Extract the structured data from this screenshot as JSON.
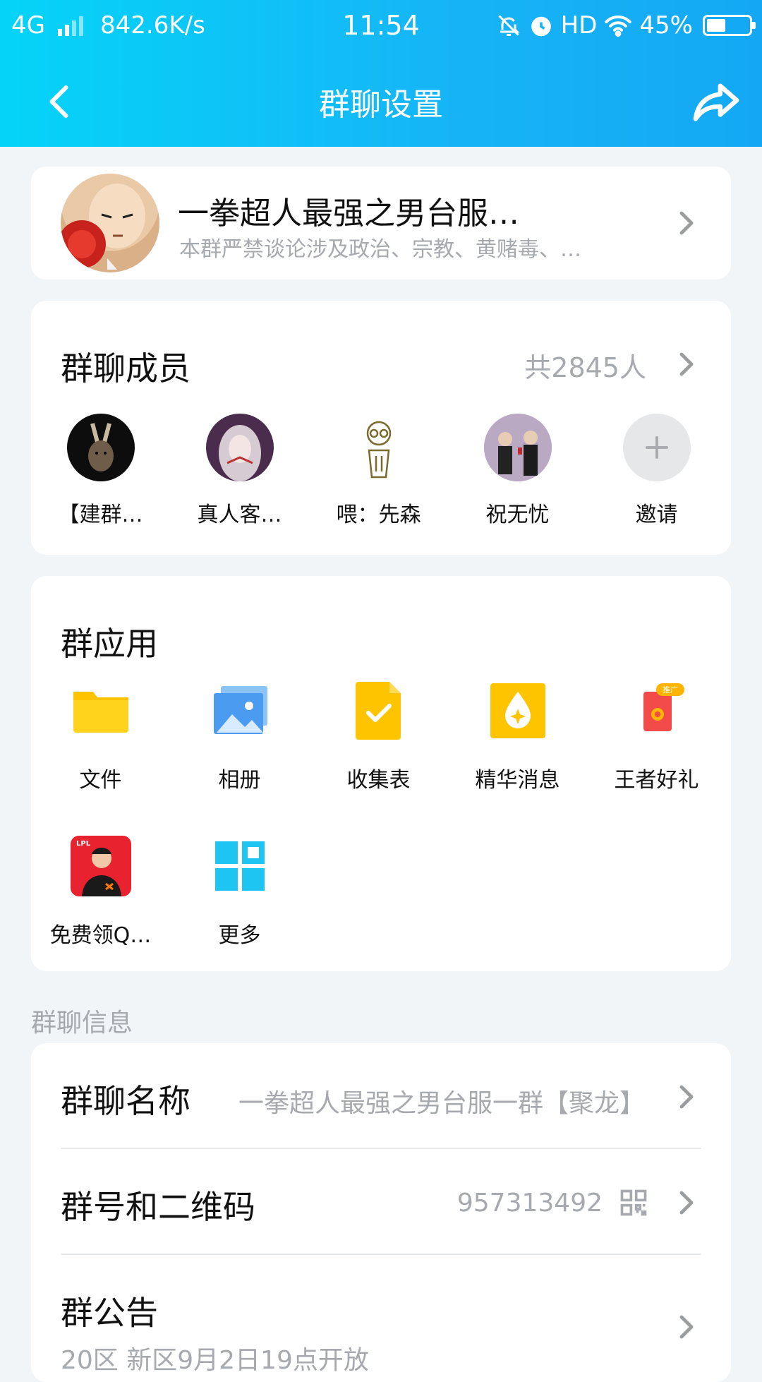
{
  "status_bar": {
    "network": "4G",
    "speed": "842.6K/s",
    "time": "11:54",
    "hd": "HD",
    "battery": "45%",
    "battery_level": 0.45
  },
  "nav": {
    "title": "群聊设置"
  },
  "group_header": {
    "name": "一拳超人最强之男台服…",
    "description": "本群严禁谈论涉及政治、宗教、黄赌毒、…"
  },
  "members": {
    "title": "群聊成员",
    "count": "共2845人",
    "list": [
      {
        "name": "【建群…"
      },
      {
        "name": "真人客…"
      },
      {
        "name": "喂：先森"
      },
      {
        "name": "祝无忧"
      },
      {
        "name": "邀请"
      }
    ]
  },
  "apps": {
    "title": "群应用",
    "items": [
      {
        "label": "文件",
        "icon": "folder-icon"
      },
      {
        "label": "相册",
        "icon": "album-icon"
      },
      {
        "label": "收集表",
        "icon": "form-icon"
      },
      {
        "label": "精华消息",
        "icon": "essence-icon"
      },
      {
        "label": "王者好礼",
        "icon": "gift-icon",
        "badge": "推广"
      },
      {
        "label": "免费领Q…",
        "icon": "promo-icon"
      },
      {
        "label": "更多",
        "icon": "more-grid-icon"
      }
    ]
  },
  "info": {
    "section_label": "群聊信息",
    "rows": [
      {
        "label": "群聊名称",
        "value": "一拳超人最强之男台服一群【聚龙】"
      },
      {
        "label": "群号和二维码",
        "value": "957313492"
      },
      {
        "label": "群公告",
        "value": "20区 新区9月2日19点开放"
      }
    ]
  },
  "colors": {
    "header_start": "#05d4f8",
    "header_end": "#14a8f4",
    "background": "#f2f5f8",
    "muted_text": "#a6a9ad"
  }
}
